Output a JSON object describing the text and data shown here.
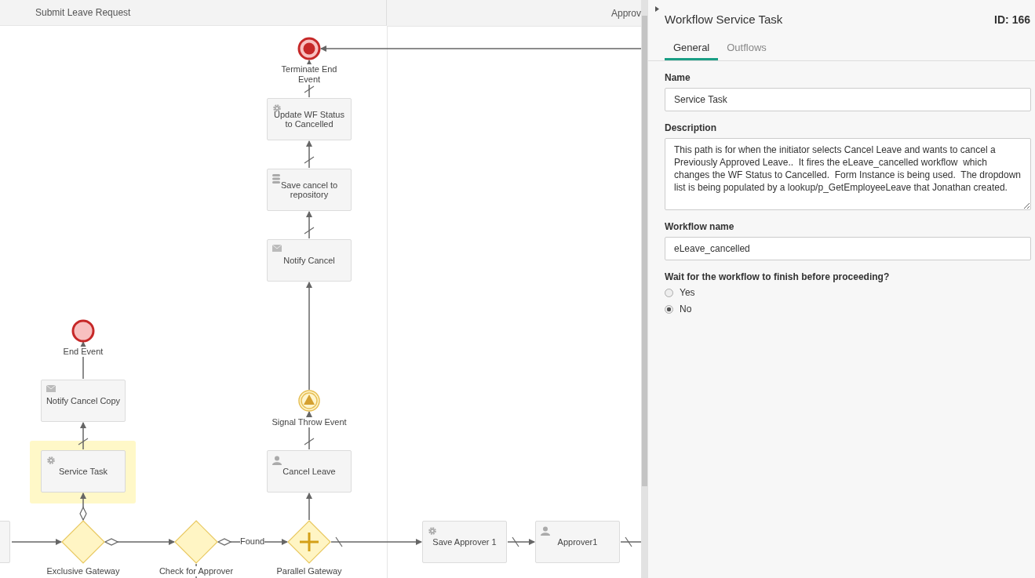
{
  "lanes": [
    {
      "title": "Submit Leave Request"
    },
    {
      "title": "Approv"
    }
  ],
  "diagram": {
    "nodes": [
      {
        "kind": "terminate-end-event",
        "label": "Terminate End Event",
        "selected": false
      },
      {
        "kind": "service-task",
        "label": "Update WF Status to Cancelled",
        "selected": false
      },
      {
        "kind": "data-task",
        "label": "Save cancel to repository",
        "selected": false
      },
      {
        "kind": "mail-task",
        "label": "Notify Cancel",
        "selected": false
      },
      {
        "kind": "end-event",
        "label": "End Event",
        "selected": false
      },
      {
        "kind": "signal-throw-event",
        "label": "Signal Throw Event",
        "selected": false
      },
      {
        "kind": "mail-task",
        "label": "Notify Cancel Copy",
        "selected": false
      },
      {
        "kind": "service-task",
        "label": "Service Task",
        "selected": true
      },
      {
        "kind": "user-task",
        "label": "Cancel Leave",
        "selected": false
      },
      {
        "kind": "task",
        "selected": false
      },
      {
        "kind": "exclusive-gateway",
        "label": "Exclusive Gateway",
        "selected": false
      },
      {
        "kind": "exclusive-gateway",
        "label": "Check for Approver",
        "selected": false
      },
      {
        "kind": "parallel-gateway",
        "label": "Parallel Gateway",
        "selected": false
      },
      {
        "kind": "service-task",
        "label": "Save Approver 1",
        "selected": false
      },
      {
        "kind": "user-task",
        "label": "Approver1",
        "selected": false
      }
    ],
    "flow_labels": [
      {
        "label": "Found"
      }
    ]
  },
  "panel": {
    "title": "Workflow Service Task",
    "id": "ID: 166",
    "tabs": [
      {
        "label": "General",
        "selected": true
      },
      {
        "label": "Outflows",
        "selected": false
      }
    ],
    "fields": [
      {
        "kind": "text",
        "label": "Name",
        "value": "Service Task"
      },
      {
        "kind": "textarea",
        "label": "Description",
        "value": "This path is for when the initiator selects Cancel Leave and wants to cancel a Previously Approved Leave..  It fires the eLeave_cancelled workflow  which changes the WF Status to Cancelled.  Form Instance is being used.  The dropdown list is being populated by a lookup/p_GetEmployeeLeave that Jonathan created."
      },
      {
        "kind": "text",
        "label": "Workflow name",
        "value": "eLeave_cancelled"
      },
      {
        "kind": "radio",
        "label": "Wait for the workflow to finish before proceeding?",
        "options": [
          {
            "label": "Yes",
            "selected": false
          },
          {
            "label": "No",
            "selected": true
          }
        ]
      }
    ]
  }
}
